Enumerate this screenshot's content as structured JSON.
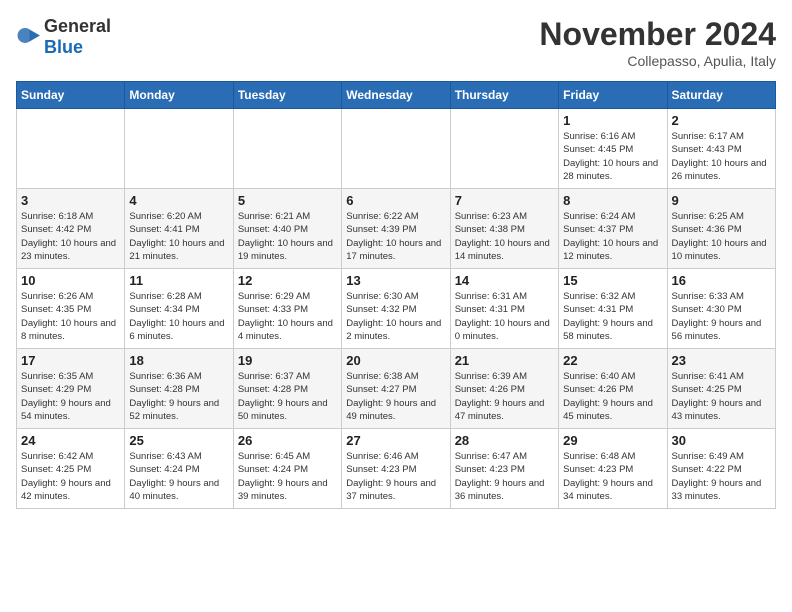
{
  "header": {
    "logo_general": "General",
    "logo_blue": "Blue",
    "month_title": "November 2024",
    "location": "Collepasso, Apulia, Italy"
  },
  "days_of_week": [
    "Sunday",
    "Monday",
    "Tuesday",
    "Wednesday",
    "Thursday",
    "Friday",
    "Saturday"
  ],
  "weeks": [
    [
      {
        "day": "",
        "detail": ""
      },
      {
        "day": "",
        "detail": ""
      },
      {
        "day": "",
        "detail": ""
      },
      {
        "day": "",
        "detail": ""
      },
      {
        "day": "",
        "detail": ""
      },
      {
        "day": "1",
        "detail": "Sunrise: 6:16 AM\nSunset: 4:45 PM\nDaylight: 10 hours and 28 minutes."
      },
      {
        "day": "2",
        "detail": "Sunrise: 6:17 AM\nSunset: 4:43 PM\nDaylight: 10 hours and 26 minutes."
      }
    ],
    [
      {
        "day": "3",
        "detail": "Sunrise: 6:18 AM\nSunset: 4:42 PM\nDaylight: 10 hours and 23 minutes."
      },
      {
        "day": "4",
        "detail": "Sunrise: 6:20 AM\nSunset: 4:41 PM\nDaylight: 10 hours and 21 minutes."
      },
      {
        "day": "5",
        "detail": "Sunrise: 6:21 AM\nSunset: 4:40 PM\nDaylight: 10 hours and 19 minutes."
      },
      {
        "day": "6",
        "detail": "Sunrise: 6:22 AM\nSunset: 4:39 PM\nDaylight: 10 hours and 17 minutes."
      },
      {
        "day": "7",
        "detail": "Sunrise: 6:23 AM\nSunset: 4:38 PM\nDaylight: 10 hours and 14 minutes."
      },
      {
        "day": "8",
        "detail": "Sunrise: 6:24 AM\nSunset: 4:37 PM\nDaylight: 10 hours and 12 minutes."
      },
      {
        "day": "9",
        "detail": "Sunrise: 6:25 AM\nSunset: 4:36 PM\nDaylight: 10 hours and 10 minutes."
      }
    ],
    [
      {
        "day": "10",
        "detail": "Sunrise: 6:26 AM\nSunset: 4:35 PM\nDaylight: 10 hours and 8 minutes."
      },
      {
        "day": "11",
        "detail": "Sunrise: 6:28 AM\nSunset: 4:34 PM\nDaylight: 10 hours and 6 minutes."
      },
      {
        "day": "12",
        "detail": "Sunrise: 6:29 AM\nSunset: 4:33 PM\nDaylight: 10 hours and 4 minutes."
      },
      {
        "day": "13",
        "detail": "Sunrise: 6:30 AM\nSunset: 4:32 PM\nDaylight: 10 hours and 2 minutes."
      },
      {
        "day": "14",
        "detail": "Sunrise: 6:31 AM\nSunset: 4:31 PM\nDaylight: 10 hours and 0 minutes."
      },
      {
        "day": "15",
        "detail": "Sunrise: 6:32 AM\nSunset: 4:31 PM\nDaylight: 9 hours and 58 minutes."
      },
      {
        "day": "16",
        "detail": "Sunrise: 6:33 AM\nSunset: 4:30 PM\nDaylight: 9 hours and 56 minutes."
      }
    ],
    [
      {
        "day": "17",
        "detail": "Sunrise: 6:35 AM\nSunset: 4:29 PM\nDaylight: 9 hours and 54 minutes."
      },
      {
        "day": "18",
        "detail": "Sunrise: 6:36 AM\nSunset: 4:28 PM\nDaylight: 9 hours and 52 minutes."
      },
      {
        "day": "19",
        "detail": "Sunrise: 6:37 AM\nSunset: 4:28 PM\nDaylight: 9 hours and 50 minutes."
      },
      {
        "day": "20",
        "detail": "Sunrise: 6:38 AM\nSunset: 4:27 PM\nDaylight: 9 hours and 49 minutes."
      },
      {
        "day": "21",
        "detail": "Sunrise: 6:39 AM\nSunset: 4:26 PM\nDaylight: 9 hours and 47 minutes."
      },
      {
        "day": "22",
        "detail": "Sunrise: 6:40 AM\nSunset: 4:26 PM\nDaylight: 9 hours and 45 minutes."
      },
      {
        "day": "23",
        "detail": "Sunrise: 6:41 AM\nSunset: 4:25 PM\nDaylight: 9 hours and 43 minutes."
      }
    ],
    [
      {
        "day": "24",
        "detail": "Sunrise: 6:42 AM\nSunset: 4:25 PM\nDaylight: 9 hours and 42 minutes."
      },
      {
        "day": "25",
        "detail": "Sunrise: 6:43 AM\nSunset: 4:24 PM\nDaylight: 9 hours and 40 minutes."
      },
      {
        "day": "26",
        "detail": "Sunrise: 6:45 AM\nSunset: 4:24 PM\nDaylight: 9 hours and 39 minutes."
      },
      {
        "day": "27",
        "detail": "Sunrise: 6:46 AM\nSunset: 4:23 PM\nDaylight: 9 hours and 37 minutes."
      },
      {
        "day": "28",
        "detail": "Sunrise: 6:47 AM\nSunset: 4:23 PM\nDaylight: 9 hours and 36 minutes."
      },
      {
        "day": "29",
        "detail": "Sunrise: 6:48 AM\nSunset: 4:23 PM\nDaylight: 9 hours and 34 minutes."
      },
      {
        "day": "30",
        "detail": "Sunrise: 6:49 AM\nSunset: 4:22 PM\nDaylight: 9 hours and 33 minutes."
      }
    ]
  ]
}
